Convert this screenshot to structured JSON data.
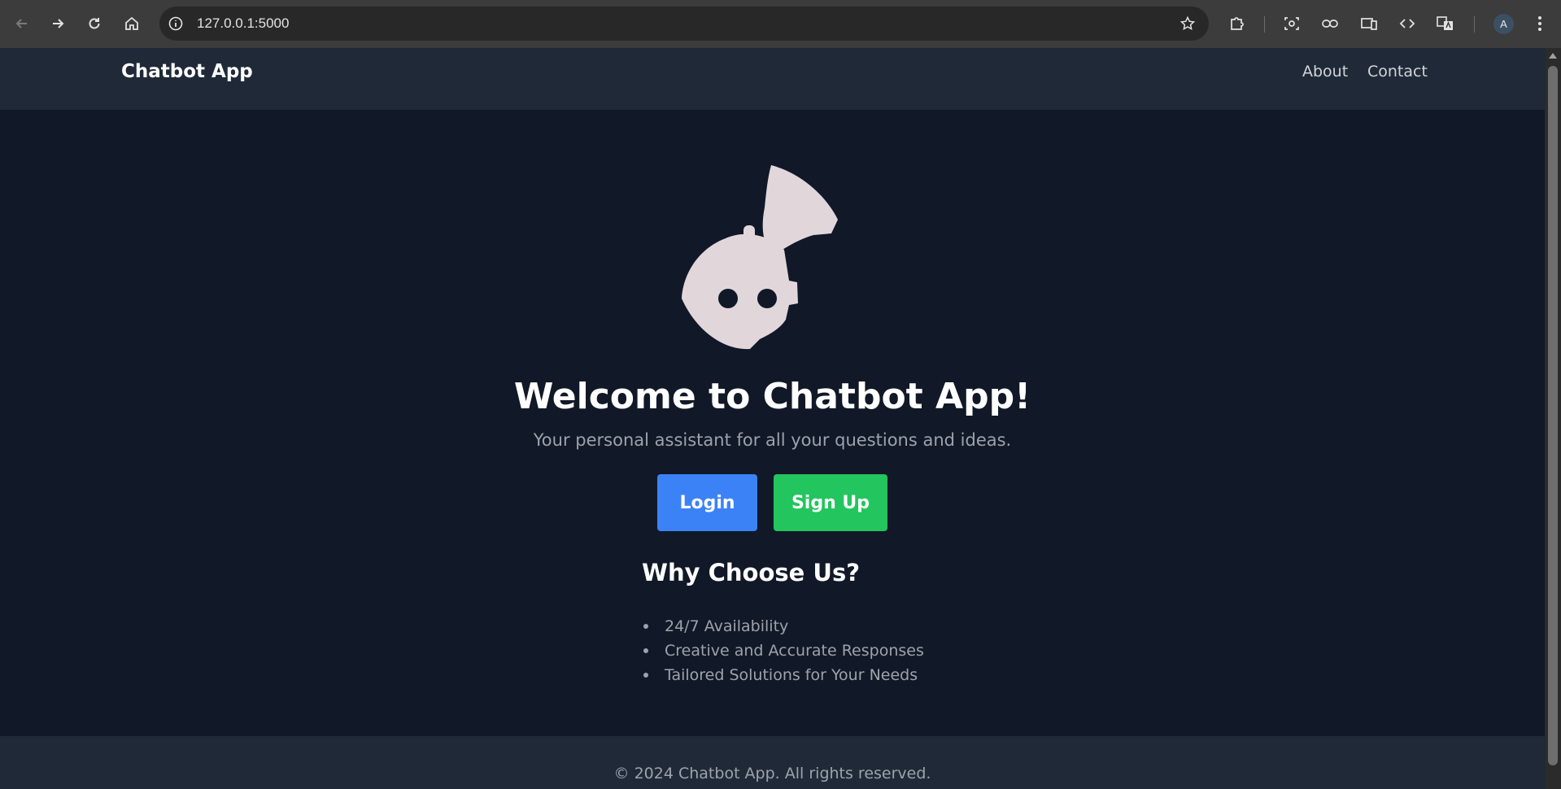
{
  "browser": {
    "url": "127.0.0.1:5000",
    "profile_initial": "A"
  },
  "header": {
    "brand": "Chatbot App",
    "nav": [
      {
        "label": "About"
      },
      {
        "label": "Contact"
      }
    ]
  },
  "hero": {
    "logo_icon": "chatbot-robot-icon",
    "title": "Welcome to Chatbot App!",
    "tagline": "Your personal assistant for all your questions and ideas.",
    "login_label": "Login",
    "signup_label": "Sign Up"
  },
  "features": {
    "title": "Why Choose Us?",
    "items": [
      "24/7 Availability",
      "Creative and Accurate Responses",
      "Tailored Solutions for Your Needs"
    ]
  },
  "footer": {
    "copyright": "© 2024 Chatbot App. All rights reserved."
  },
  "colors": {
    "page_bg": "#111827",
    "header_bg": "#1f2937",
    "login": "#3b82f6",
    "signup": "#22c55e",
    "logo": "#e1d7db"
  }
}
